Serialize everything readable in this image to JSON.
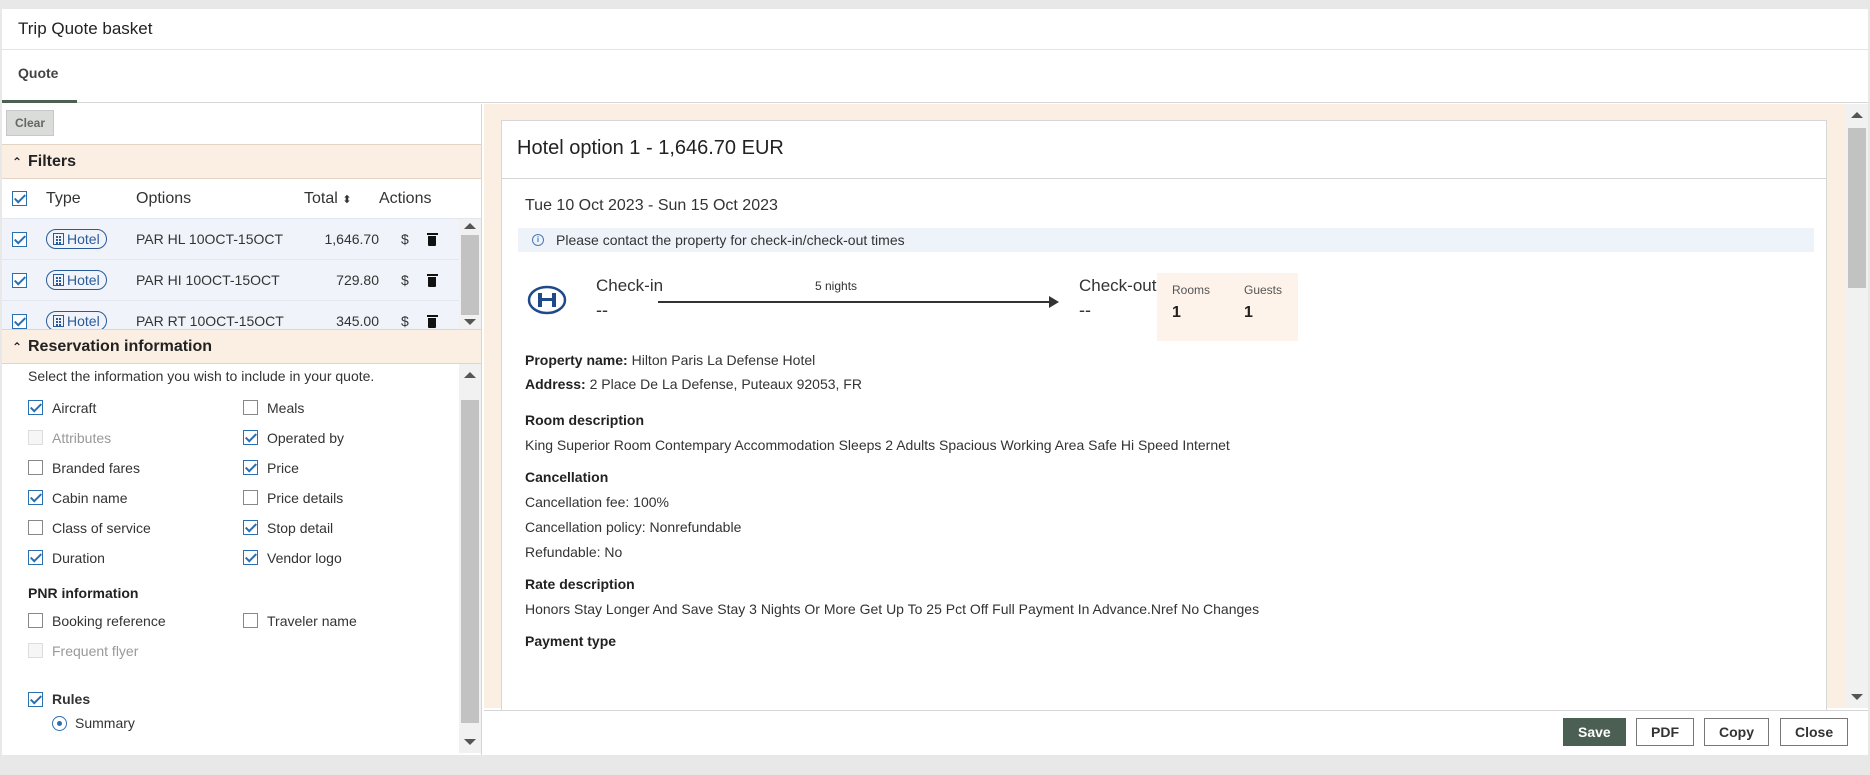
{
  "window": {
    "title": "Trip Quote basket"
  },
  "tabs": [
    {
      "label": "Quote"
    }
  ],
  "toolbar": {
    "clear_label": "Clear"
  },
  "filters": {
    "title": "Filters",
    "columns": {
      "type": "Type",
      "options": "Options",
      "total": "Total",
      "actions": "Actions"
    },
    "rows": [
      {
        "type": "Hotel",
        "options": "PAR HL 10OCT-15OCT",
        "total": "1,646.70",
        "price_action": "$"
      },
      {
        "type": "Hotel",
        "options": "PAR HI 10OCT-15OCT",
        "total": "729.80",
        "price_action": "$"
      },
      {
        "type": "Hotel",
        "options": "PAR RT 10OCT-15OCT",
        "total": "345.00",
        "price_action": "$"
      }
    ]
  },
  "reservation": {
    "title": "Reservation information",
    "intro": "Select the information you wish to include in your quote.",
    "options": [
      {
        "label": "Aircraft",
        "checked": true,
        "disabled": false
      },
      {
        "label": "Meals",
        "checked": false,
        "disabled": false
      },
      {
        "label": "Attributes",
        "checked": false,
        "disabled": true
      },
      {
        "label": "Operated by",
        "checked": true,
        "disabled": false
      },
      {
        "label": "Branded fares",
        "checked": false,
        "disabled": false
      },
      {
        "label": "Price",
        "checked": true,
        "disabled": false
      },
      {
        "label": "Cabin name",
        "checked": true,
        "disabled": false
      },
      {
        "label": "Price details",
        "checked": false,
        "disabled": false
      },
      {
        "label": "Class of service",
        "checked": false,
        "disabled": false
      },
      {
        "label": "Stop detail",
        "checked": true,
        "disabled": false
      },
      {
        "label": "Duration",
        "checked": true,
        "disabled": false
      },
      {
        "label": "Vendor logo",
        "checked": true,
        "disabled": false
      }
    ],
    "pnr_title": "PNR information",
    "pnr_options": [
      {
        "label": "Booking reference",
        "checked": false,
        "disabled": false
      },
      {
        "label": "Traveler name",
        "checked": false,
        "disabled": false
      },
      {
        "label": "Frequent flyer",
        "checked": false,
        "disabled": true
      }
    ],
    "rules_label": "Rules",
    "summary_label": "Summary"
  },
  "hotel": {
    "title": "Hotel option 1 - 1,646.70 EUR",
    "dates": "Tue 10 Oct 2023 - Sun 15 Oct 2023",
    "notice": "Please contact the property for check-in/check-out times",
    "checkin_label": "Check-in",
    "checkin_value": "--",
    "nights": "5 nights",
    "checkout_label": "Check-out",
    "checkout_value": "--",
    "rooms_label": "Rooms",
    "rooms_value": "1",
    "guests_label": "Guests",
    "guests_value": "1",
    "property_name_label": "Property name:",
    "property_name": "Hilton Paris La Defense Hotel",
    "address_label": "Address:",
    "address": "2 Place De La Defense, Puteaux 92053, FR",
    "room_desc_title": "Room description",
    "room_desc": "King Superior Room Contempary Accommodation Sleeps 2 Adults Spacious Working Area Safe Hi Speed Internet",
    "cancellation_title": "Cancellation",
    "cancellation_fee": "Cancellation fee: 100%",
    "cancellation_policy": "Cancellation policy: Nonrefundable",
    "refundable": "Refundable: No",
    "rate_desc_title": "Rate description",
    "rate_desc": "Honors Stay Longer And Save Stay 3 Nights Or More Get Up To 25 Pct Off Full Payment In Advance.Nref No Changes",
    "payment_title": "Payment type"
  },
  "footer": {
    "save": "Save",
    "pdf": "PDF",
    "copy": "Copy",
    "close": "Close"
  },
  "colors": {
    "accent": "#4b5f52",
    "section_bg": "#fbeee2",
    "link_blue": "#2a5a9a"
  }
}
